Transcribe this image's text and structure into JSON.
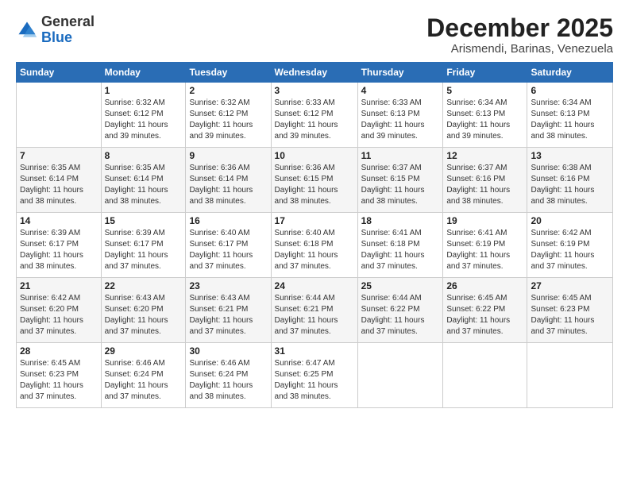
{
  "header": {
    "logo_general": "General",
    "logo_blue": "Blue",
    "month": "December 2025",
    "location": "Arismendi, Barinas, Venezuela"
  },
  "days_of_week": [
    "Sunday",
    "Monday",
    "Tuesday",
    "Wednesday",
    "Thursday",
    "Friday",
    "Saturday"
  ],
  "weeks": [
    [
      {
        "day": "",
        "text": ""
      },
      {
        "day": "1",
        "text": "Sunrise: 6:32 AM\nSunset: 6:12 PM\nDaylight: 11 hours\nand 39 minutes."
      },
      {
        "day": "2",
        "text": "Sunrise: 6:32 AM\nSunset: 6:12 PM\nDaylight: 11 hours\nand 39 minutes."
      },
      {
        "day": "3",
        "text": "Sunrise: 6:33 AM\nSunset: 6:12 PM\nDaylight: 11 hours\nand 39 minutes."
      },
      {
        "day": "4",
        "text": "Sunrise: 6:33 AM\nSunset: 6:13 PM\nDaylight: 11 hours\nand 39 minutes."
      },
      {
        "day": "5",
        "text": "Sunrise: 6:34 AM\nSunset: 6:13 PM\nDaylight: 11 hours\nand 39 minutes."
      },
      {
        "day": "6",
        "text": "Sunrise: 6:34 AM\nSunset: 6:13 PM\nDaylight: 11 hours\nand 38 minutes."
      }
    ],
    [
      {
        "day": "7",
        "text": "Sunrise: 6:35 AM\nSunset: 6:14 PM\nDaylight: 11 hours\nand 38 minutes."
      },
      {
        "day": "8",
        "text": "Sunrise: 6:35 AM\nSunset: 6:14 PM\nDaylight: 11 hours\nand 38 minutes."
      },
      {
        "day": "9",
        "text": "Sunrise: 6:36 AM\nSunset: 6:14 PM\nDaylight: 11 hours\nand 38 minutes."
      },
      {
        "day": "10",
        "text": "Sunrise: 6:36 AM\nSunset: 6:15 PM\nDaylight: 11 hours\nand 38 minutes."
      },
      {
        "day": "11",
        "text": "Sunrise: 6:37 AM\nSunset: 6:15 PM\nDaylight: 11 hours\nand 38 minutes."
      },
      {
        "day": "12",
        "text": "Sunrise: 6:37 AM\nSunset: 6:16 PM\nDaylight: 11 hours\nand 38 minutes."
      },
      {
        "day": "13",
        "text": "Sunrise: 6:38 AM\nSunset: 6:16 PM\nDaylight: 11 hours\nand 38 minutes."
      }
    ],
    [
      {
        "day": "14",
        "text": "Sunrise: 6:39 AM\nSunset: 6:17 PM\nDaylight: 11 hours\nand 38 minutes."
      },
      {
        "day": "15",
        "text": "Sunrise: 6:39 AM\nSunset: 6:17 PM\nDaylight: 11 hours\nand 37 minutes."
      },
      {
        "day": "16",
        "text": "Sunrise: 6:40 AM\nSunset: 6:17 PM\nDaylight: 11 hours\nand 37 minutes."
      },
      {
        "day": "17",
        "text": "Sunrise: 6:40 AM\nSunset: 6:18 PM\nDaylight: 11 hours\nand 37 minutes."
      },
      {
        "day": "18",
        "text": "Sunrise: 6:41 AM\nSunset: 6:18 PM\nDaylight: 11 hours\nand 37 minutes."
      },
      {
        "day": "19",
        "text": "Sunrise: 6:41 AM\nSunset: 6:19 PM\nDaylight: 11 hours\nand 37 minutes."
      },
      {
        "day": "20",
        "text": "Sunrise: 6:42 AM\nSunset: 6:19 PM\nDaylight: 11 hours\nand 37 minutes."
      }
    ],
    [
      {
        "day": "21",
        "text": "Sunrise: 6:42 AM\nSunset: 6:20 PM\nDaylight: 11 hours\nand 37 minutes."
      },
      {
        "day": "22",
        "text": "Sunrise: 6:43 AM\nSunset: 6:20 PM\nDaylight: 11 hours\nand 37 minutes."
      },
      {
        "day": "23",
        "text": "Sunrise: 6:43 AM\nSunset: 6:21 PM\nDaylight: 11 hours\nand 37 minutes."
      },
      {
        "day": "24",
        "text": "Sunrise: 6:44 AM\nSunset: 6:21 PM\nDaylight: 11 hours\nand 37 minutes."
      },
      {
        "day": "25",
        "text": "Sunrise: 6:44 AM\nSunset: 6:22 PM\nDaylight: 11 hours\nand 37 minutes."
      },
      {
        "day": "26",
        "text": "Sunrise: 6:45 AM\nSunset: 6:22 PM\nDaylight: 11 hours\nand 37 minutes."
      },
      {
        "day": "27",
        "text": "Sunrise: 6:45 AM\nSunset: 6:23 PM\nDaylight: 11 hours\nand 37 minutes."
      }
    ],
    [
      {
        "day": "28",
        "text": "Sunrise: 6:45 AM\nSunset: 6:23 PM\nDaylight: 11 hours\nand 37 minutes."
      },
      {
        "day": "29",
        "text": "Sunrise: 6:46 AM\nSunset: 6:24 PM\nDaylight: 11 hours\nand 37 minutes."
      },
      {
        "day": "30",
        "text": "Sunrise: 6:46 AM\nSunset: 6:24 PM\nDaylight: 11 hours\nand 38 minutes."
      },
      {
        "day": "31",
        "text": "Sunrise: 6:47 AM\nSunset: 6:25 PM\nDaylight: 11 hours\nand 38 minutes."
      },
      {
        "day": "",
        "text": ""
      },
      {
        "day": "",
        "text": ""
      },
      {
        "day": "",
        "text": ""
      }
    ]
  ]
}
